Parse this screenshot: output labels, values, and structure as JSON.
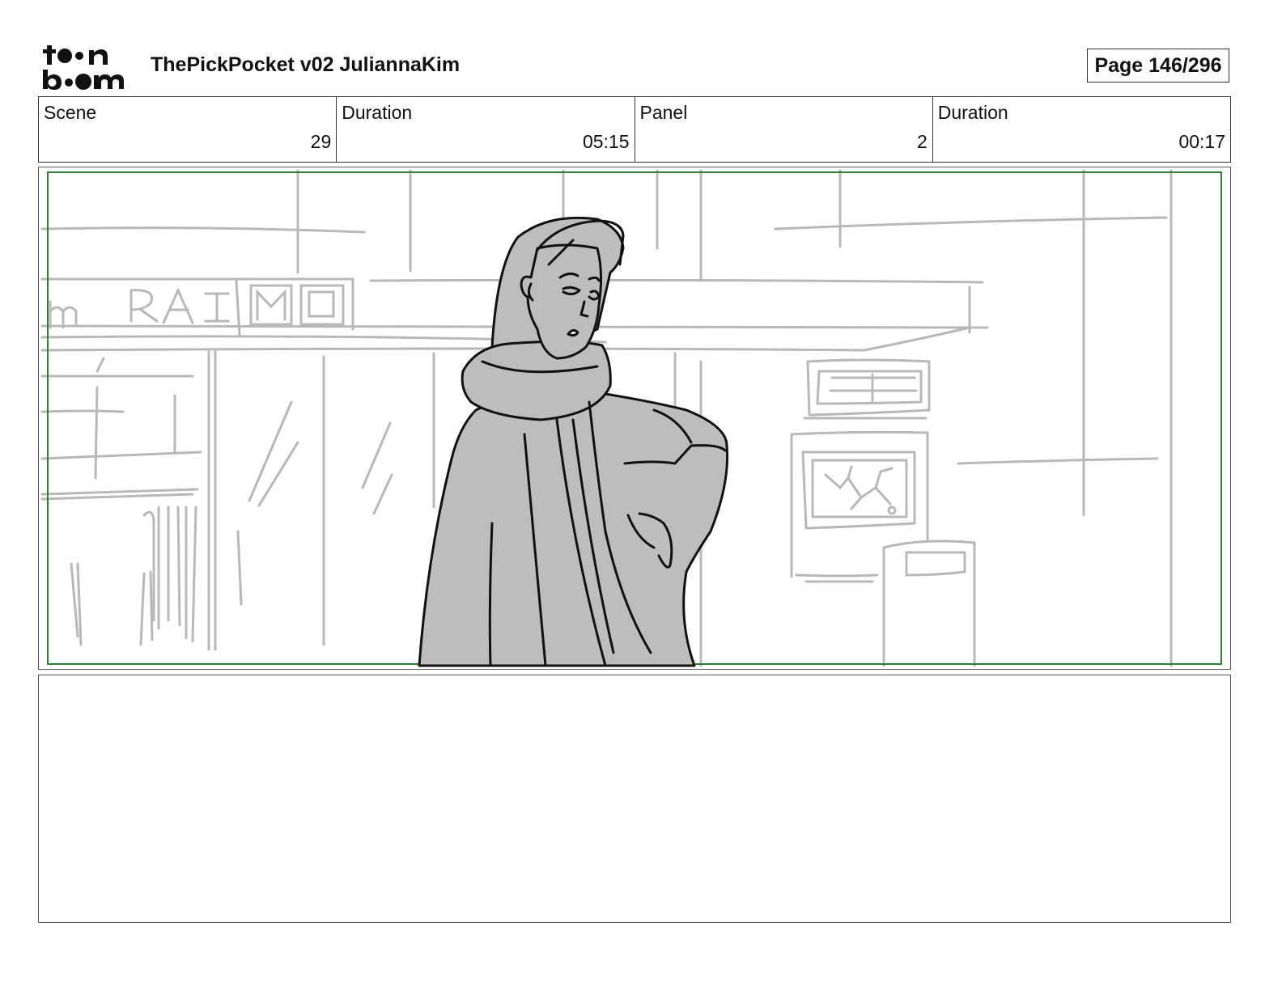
{
  "header": {
    "logo_text": "toonboom",
    "title": "ThePickPocket v02 JuliannaKim",
    "page": "Page 146/296"
  },
  "info": [
    {
      "label": "Scene",
      "value": "29"
    },
    {
      "label": "Duration",
      "value": "05:15"
    },
    {
      "label": "Panel",
      "value": "2"
    },
    {
      "label": "Duration",
      "value": "00:17"
    }
  ],
  "panel": {
    "sign_text": "m RAI",
    "safe_frame_color": "#2e7d32",
    "sketch_color": "#b8b8b8",
    "figure_fill": "#bdbdbd"
  },
  "notes": {
    "text": ""
  }
}
